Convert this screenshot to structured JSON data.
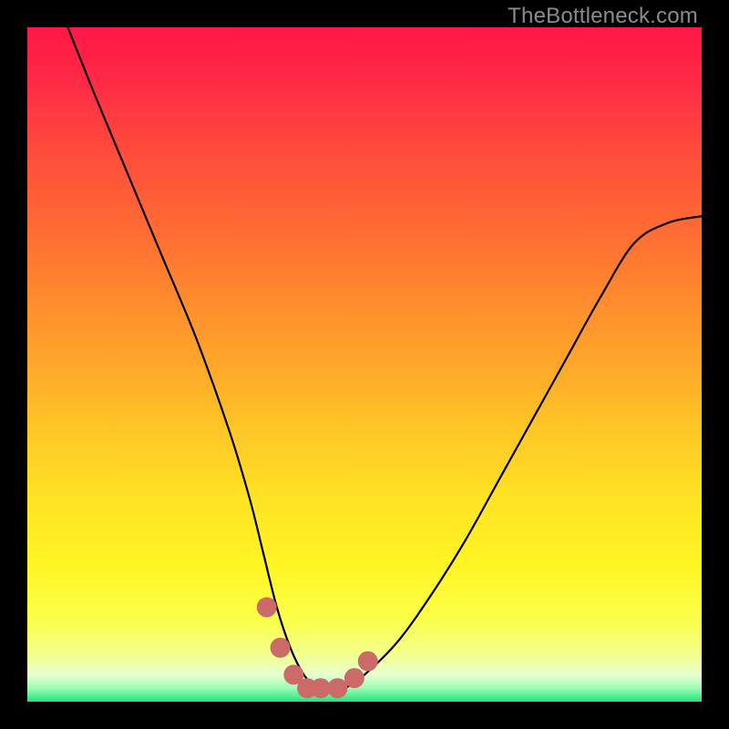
{
  "watermark_text": "TheBottleneck.com",
  "colors": {
    "frame": "#000000",
    "curve": "#000000",
    "marker_fill": "#cc6a6a",
    "marker_stroke": "#b85656",
    "watermark": "#8b8b8b"
  },
  "chart_data": {
    "type": "line",
    "title": "",
    "xlabel": "",
    "ylabel": "",
    "xlim": [
      0,
      100
    ],
    "ylim": [
      0,
      100
    ],
    "grid": false,
    "legend": false,
    "series": [
      {
        "name": "bottleneck-curve",
        "x": [
          6,
          10,
          15,
          20,
          25,
          30,
          33,
          35,
          37,
          39,
          41,
          43,
          45,
          47,
          50,
          55,
          60,
          65,
          70,
          75,
          80,
          85,
          90,
          95,
          100
        ],
        "y": [
          100,
          90,
          78,
          66,
          54,
          40,
          30,
          22,
          14,
          8,
          4,
          2,
          2,
          2,
          4,
          9,
          16,
          24,
          33,
          42,
          51,
          60,
          68,
          71,
          72
        ]
      }
    ],
    "markers": {
      "name": "valley-markers",
      "x": [
        35.5,
        37.5,
        39.5,
        41.5,
        43.5,
        46,
        48.5,
        50.5
      ],
      "y": [
        14,
        8,
        4,
        2,
        2,
        2,
        3.5,
        6
      ]
    }
  }
}
